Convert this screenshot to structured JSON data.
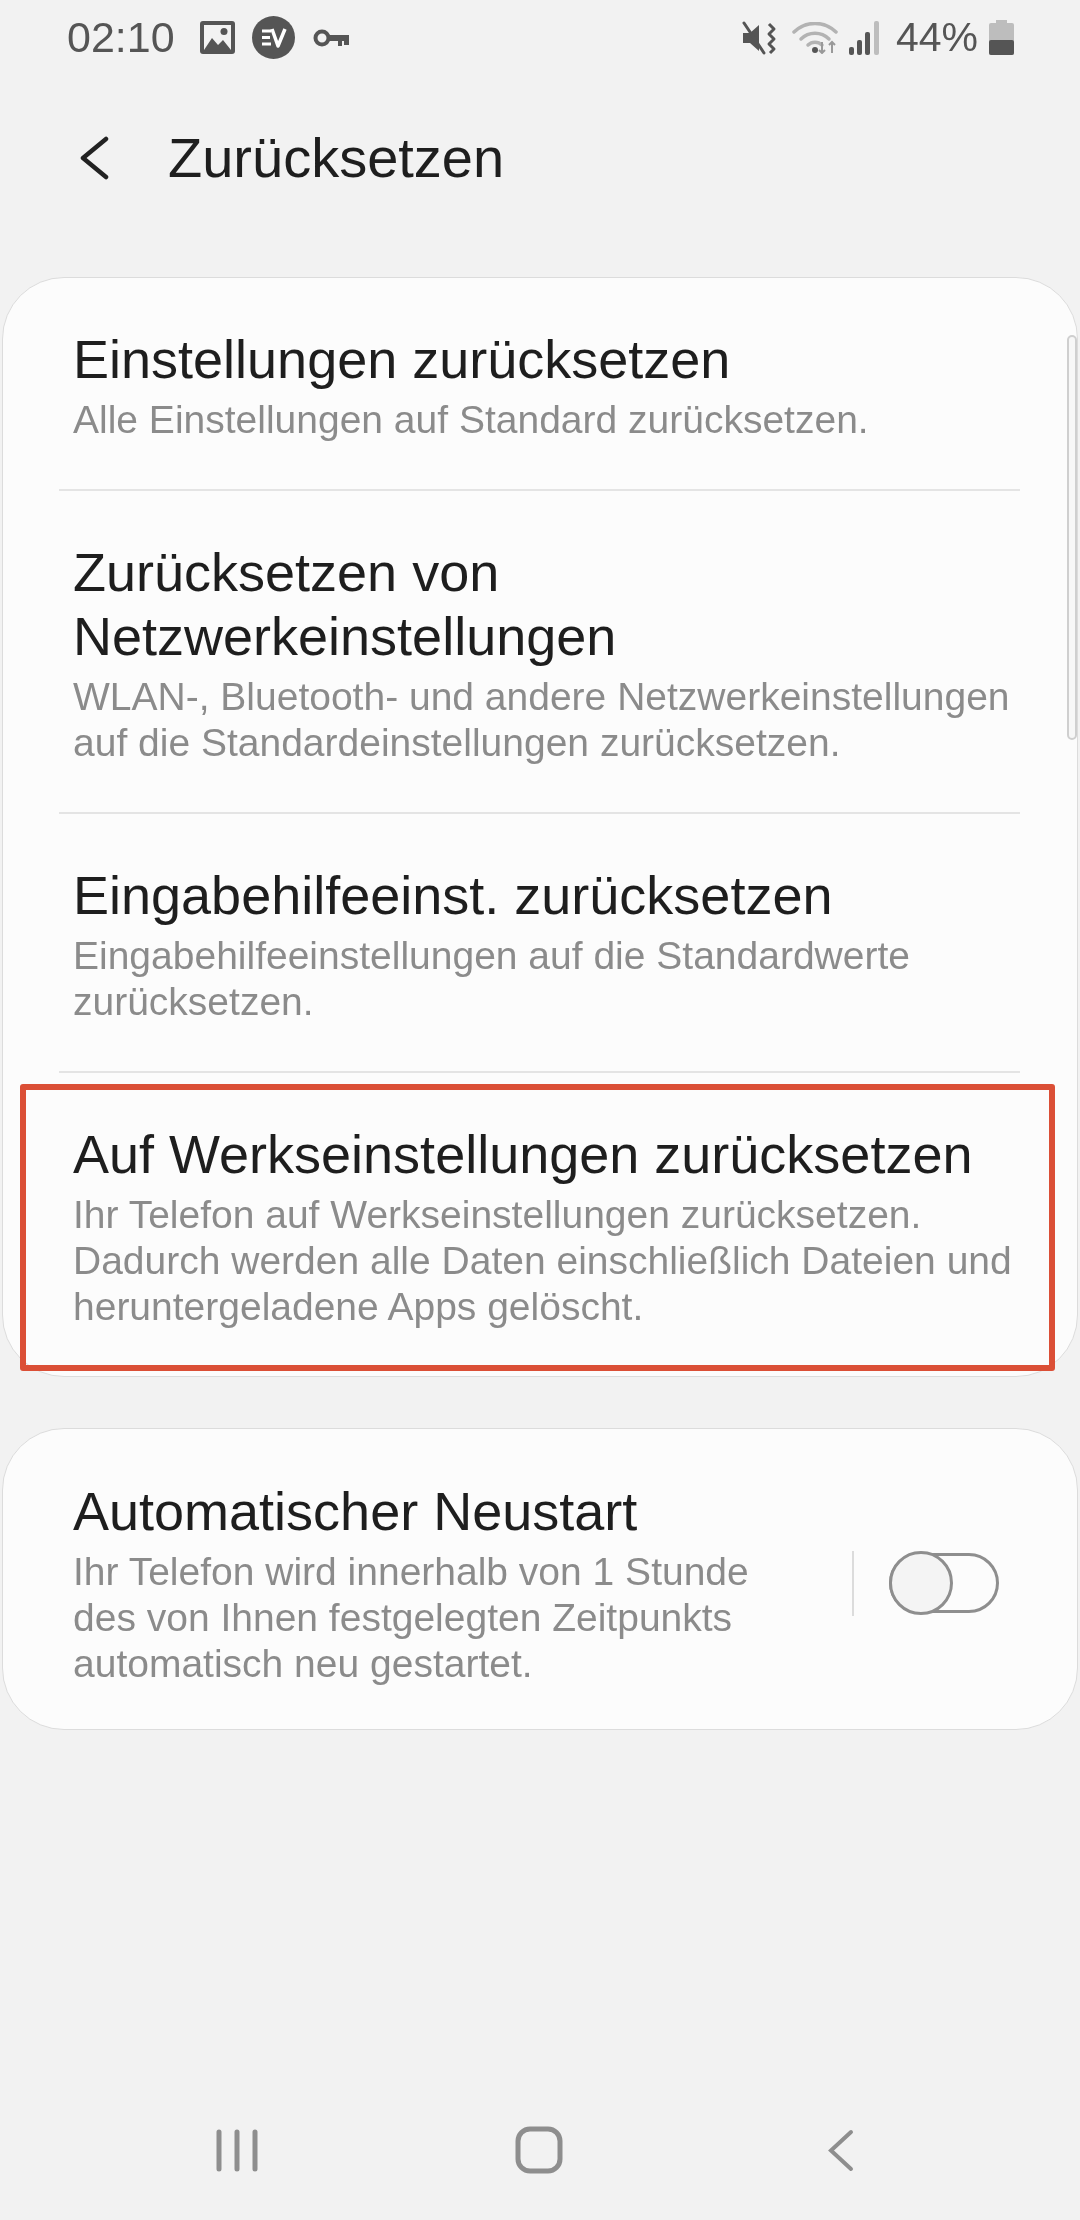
{
  "status_bar": {
    "time": "02:10",
    "battery_text": "44%"
  },
  "header": {
    "title": "Zurücksetzen"
  },
  "groups": [
    {
      "items": [
        {
          "kind": "action",
          "title": "Einstellungen zurücksetzen",
          "subtitle": "Alle Einstellungen auf Standard zurücksetzen.",
          "highlighted": false
        },
        {
          "kind": "action",
          "title": "Zurücksetzen von Netzwerkeinstellungen",
          "subtitle": "WLAN-, Bluetooth- und andere Netzwerkeinstellungen auf die Standardeinstellungen zurücksetzen.",
          "highlighted": false
        },
        {
          "kind": "action",
          "title": "Eingabehilfeeinst. zurücksetzen",
          "subtitle": "Eingabehilfeeinstellungen auf die Standardwerte zurücksetzen.",
          "highlighted": false
        },
        {
          "kind": "action",
          "title": "Auf Werkseinstellungen zurücksetzen",
          "subtitle": "Ihr Telefon auf Werkseinstellungen zurücksetzen. Dadurch werden alle Daten einschließlich Dateien und heruntergeladene Apps gelöscht.",
          "highlighted": true
        }
      ]
    },
    {
      "items": [
        {
          "kind": "toggle",
          "title": "Automatischer Neustart",
          "subtitle": "Ihr Telefon wird innerhalb von 1 Stunde des von Ihnen festgelegten Zeitpunkts automatisch neu gestartet.",
          "on": false,
          "highlighted": false
        }
      ]
    }
  ]
}
